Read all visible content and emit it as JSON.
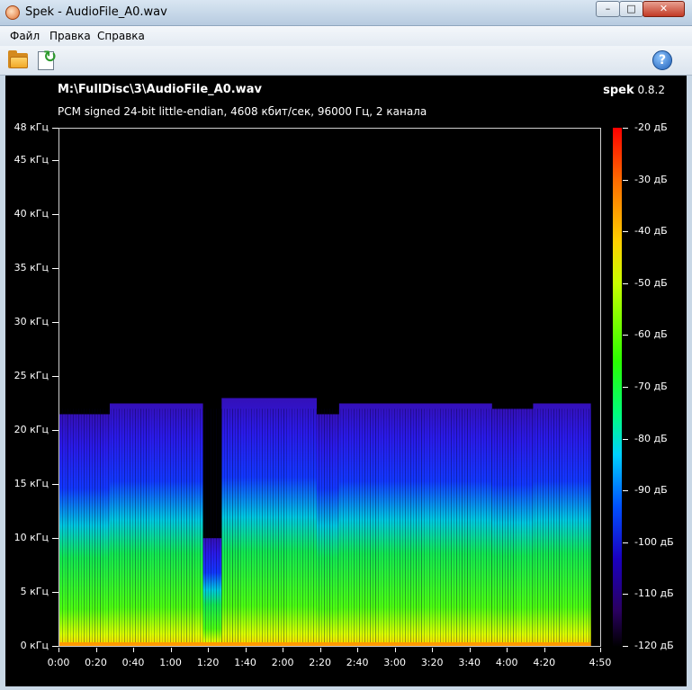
{
  "window": {
    "title": "Spek - AudioFile_A0.wav",
    "controls": {
      "minimize": "–",
      "maximize": "□",
      "close": "✕"
    }
  },
  "menu": [
    "Файл",
    "Правка",
    "Справка"
  ],
  "toolbar": {
    "open_icon": "folder-open-icon",
    "save_icon": "save-image-icon",
    "help_icon": "help-icon",
    "help_glyph": "?"
  },
  "header": {
    "file_path": "M:\\FullDisc\\3\\AudioFile_A0.wav",
    "app_name": "spek",
    "version": "0.8.2",
    "stream_info": "PCM signed 24-bit little-endian, 4608 кбит/сек, 96000 Гц, 2 канала"
  },
  "chart_data": {
    "type": "heatmap",
    "y_ticks": [
      "48 кГц",
      "45 кГц",
      "40 кГц",
      "35 кГц",
      "30 кГц",
      "25 кГц",
      "20 кГц",
      "15 кГц",
      "10 кГц",
      "5 кГц",
      "0 кГц"
    ],
    "y_values_khz": [
      48,
      45,
      40,
      35,
      30,
      25,
      20,
      15,
      10,
      5,
      0
    ],
    "ylim": [
      0,
      48
    ],
    "x_ticks": [
      "0:00",
      "0:20",
      "0:40",
      "1:00",
      "1:20",
      "1:40",
      "2:00",
      "2:20",
      "2:40",
      "3:00",
      "3:20",
      "3:40",
      "4:00",
      "4:20",
      "4:50"
    ],
    "x_values_sec": [
      0,
      20,
      40,
      60,
      80,
      100,
      120,
      140,
      160,
      180,
      200,
      220,
      240,
      260,
      290
    ],
    "xlim": [
      0,
      290
    ],
    "colorbar_ticks": [
      "-20 дБ",
      "-30 дБ",
      "-40 дБ",
      "-50 дБ",
      "-60 дБ",
      "-70 дБ",
      "-80 дБ",
      "-90 дБ",
      "-100 дБ",
      "-110 дБ",
      "-120 дБ"
    ],
    "colorbar_values_db": [
      -20,
      -30,
      -40,
      -50,
      -60,
      -70,
      -80,
      -90,
      -100,
      -110,
      -120
    ],
    "colorbar_range": [
      -120,
      -20
    ],
    "segments": [
      {
        "start": 0,
        "end": 4,
        "top_khz": 21.5
      },
      {
        "start": 4,
        "end": 27,
        "top_khz": 21.5
      },
      {
        "start": 27,
        "end": 77,
        "top_khz": 22.5
      },
      {
        "start": 77,
        "end": 87,
        "top_khz": 10
      },
      {
        "start": 87,
        "end": 138,
        "top_khz": 23
      },
      {
        "start": 138,
        "end": 150,
        "top_khz": 21.5
      },
      {
        "start": 150,
        "end": 232,
        "top_khz": 22.5
      },
      {
        "start": 232,
        "end": 254,
        "top_khz": 22
      },
      {
        "start": 254,
        "end": 285,
        "top_khz": 22.5
      }
    ]
  }
}
